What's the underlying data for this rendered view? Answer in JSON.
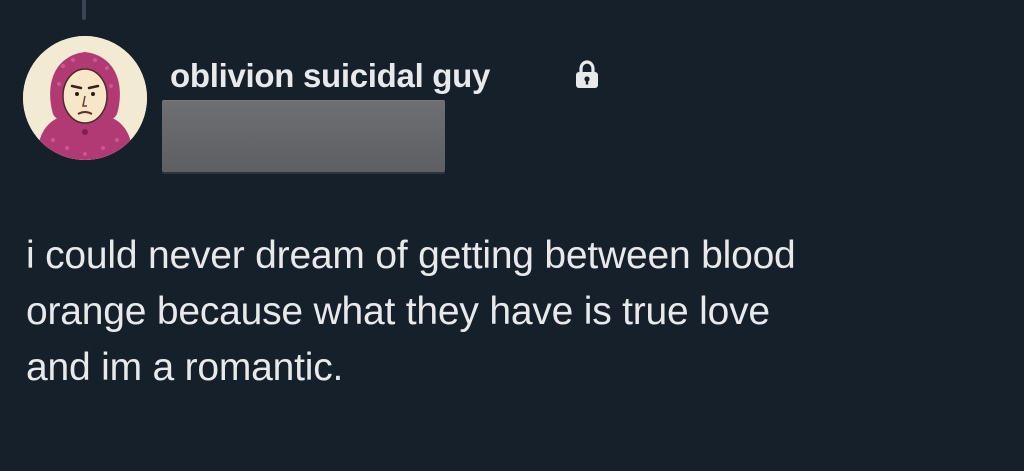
{
  "tweet": {
    "author": {
      "display_name": "oblivion suicidal guy",
      "protected_icon": "lock-icon",
      "avatar_icon": "hooded-cartoon-avatar",
      "handle_redacted": true
    },
    "text_lines": [
      "i could never dream of getting between blood",
      "orange because what they have is true love",
      "and im a romantic."
    ]
  },
  "colors": {
    "background": "#16202b",
    "text": "#e7e9ea",
    "thread_line": "#3b4450",
    "redaction": "#6a6b6f"
  }
}
